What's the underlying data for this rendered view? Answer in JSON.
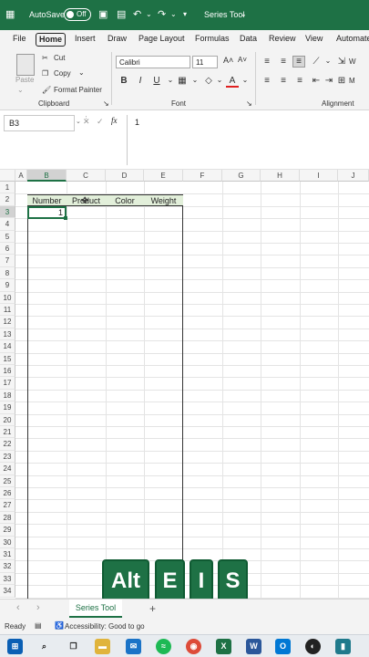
{
  "titlebar": {
    "autosave": "AutoSave",
    "toggle": "Off",
    "doc": "Series Tool",
    "save_icon": "save-icon",
    "undo_icon": "undo-icon",
    "redo_icon": "redo-icon"
  },
  "tabs": [
    "File",
    "Home",
    "Insert",
    "Draw",
    "Page Layout",
    "Formulas",
    "Data",
    "Review",
    "View",
    "Automate"
  ],
  "clipboard": {
    "paste": "Paste",
    "cut": "Cut",
    "copy": "Copy",
    "painter": "Format Painter",
    "label": "Clipboard"
  },
  "font": {
    "name": "Calibri",
    "size": "11",
    "bold": "B",
    "italic": "I",
    "underline": "U",
    "color_a": "A",
    "label": "Font"
  },
  "alignment": {
    "wrap": "W",
    "merge": "M",
    "label": "Alignment"
  },
  "formula": {
    "cell": "B3",
    "x": "✕",
    "check": "✓",
    "fx": "fx",
    "value": "1"
  },
  "columns": [
    "A",
    "B",
    "C",
    "D",
    "E",
    "F",
    "G",
    "H",
    "I",
    "J"
  ],
  "rows": [
    "1",
    "2",
    "3",
    "4",
    "5",
    "6",
    "7",
    "8",
    "9",
    "10",
    "11",
    "12",
    "13",
    "14",
    "15",
    "16",
    "17",
    "18",
    "19",
    "20",
    "21",
    "22",
    "23",
    "24",
    "25",
    "26",
    "27",
    "28",
    "29",
    "30",
    "31",
    "32",
    "33",
    "34"
  ],
  "table": {
    "headers": [
      "Number",
      "Product",
      "Color",
      "Weight"
    ],
    "b3": "1"
  },
  "keys": [
    "Alt",
    "E",
    "I",
    "S"
  ],
  "sheet": {
    "tab": "Series Tool",
    "add": "+",
    "prev": "‹",
    "next": "›"
  },
  "status": {
    "ready": "Ready",
    "accessibility": "Accessibility: Good to go"
  },
  "colors": {
    "brand": "#1e7145",
    "header_fill": "#e2efda"
  }
}
